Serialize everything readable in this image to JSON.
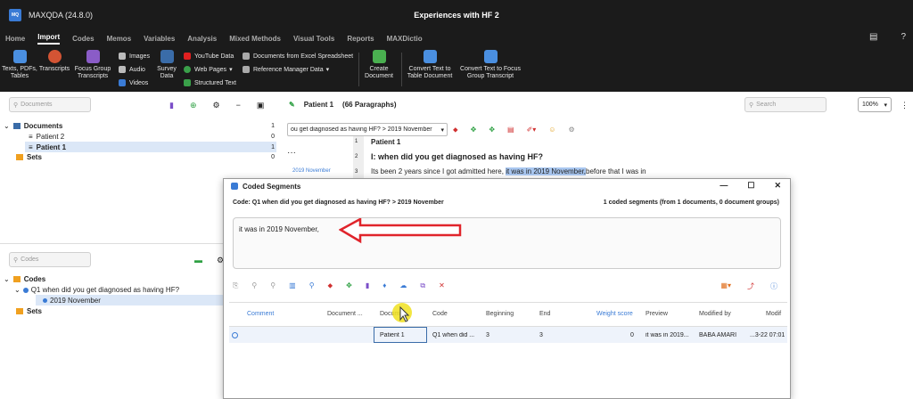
{
  "app": {
    "name": "MAXQDA (24.8.0)",
    "logo": "MQ",
    "document_title": "Experiences with HF 2"
  },
  "menu": [
    "Home",
    "Import",
    "Codes",
    "Memos",
    "Variables",
    "Analysis",
    "Mixed Methods",
    "Visual Tools",
    "Reports",
    "MAXDictio"
  ],
  "menu_active": "Import",
  "ribbon": {
    "texts": "Texts, PDFs, Tables",
    "transcripts": "Transcripts",
    "focus_group": "Focus Group Transcripts",
    "images": "Images",
    "audio": "Audio",
    "videos": "Videos",
    "survey": "Survey Data",
    "youtube": "YouTube Data",
    "webpages": "Web Pages",
    "structured": "Structured Text",
    "excel": "Documents from Excel Spreadsheet",
    "refmgr": "Reference Manager Data",
    "create_doc": "Create Document",
    "convert_table": "Convert Text to Table Document",
    "convert_focus": "Convert Text to Focus Group Transcript"
  },
  "left": {
    "documents_search": "Documents",
    "documents_root": "Documents",
    "documents_root_count": "1",
    "docs": [
      {
        "label": "Patient 2",
        "count": "0"
      },
      {
        "label": "Patient 1",
        "count": "1"
      }
    ],
    "sets": "Sets",
    "sets_count": "0",
    "codes_search": "Codes",
    "codes_root": "Codes",
    "code": "Q1 when did you get diagnosed as having HF?",
    "subcode": "2019 November",
    "code_sets": "Sets"
  },
  "right": {
    "doc_name": "Patient 1",
    "paragraphs": "(66 Paragraphs)",
    "search": "Search",
    "zoom": "100%",
    "code_dropdown": "ou get diagnosed as having HF? > 2019 November",
    "lines": [
      {
        "num": "1",
        "text": "Patient 1"
      },
      {
        "num": "2",
        "text": "I: when did you get diagnosed as having HF?"
      },
      {
        "num": "3",
        "pre": "Its been 2 years since I got admitted here, ",
        "highlight": "it was in 2019 November,",
        "post": "before that I was in"
      }
    ],
    "margin_code": "2019 November"
  },
  "dialog": {
    "title": "Coded Segments",
    "code_label": "Code: Q1 when did you get diagnosed as having HF? > 2019 November",
    "summary": "1 coded segments (from 1 documents, 0 document groups)",
    "preview_text": "it was in 2019 November,",
    "headers": [
      "Comment",
      "Document ...",
      "Docum...",
      "Code",
      "Beginning",
      "End",
      "Weight score",
      "Preview",
      "Modified by",
      "Modif"
    ],
    "row": [
      "",
      "",
      "Patient 1",
      "Q1 when did ...",
      "3",
      "3",
      "0",
      "it was in 2019...",
      "BABA  AMARI",
      "...3-22 07:01"
    ]
  },
  "colors": {
    "accent": "#3a7bd5",
    "highlight": "#a9c7f0",
    "arrow": "#e0242b"
  }
}
